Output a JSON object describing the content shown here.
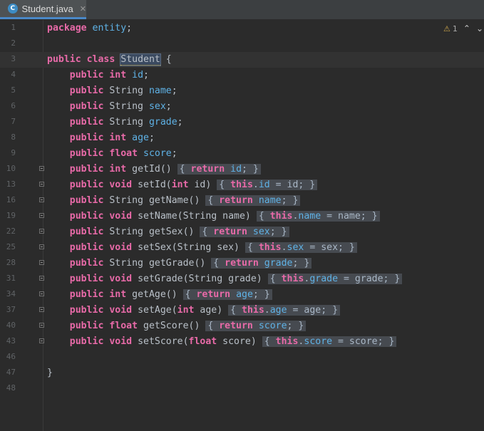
{
  "tab": {
    "icon_letter": "C",
    "label": "Student.java",
    "close": "✕"
  },
  "inspection": {
    "icon": "⚠",
    "count": "1",
    "up": "⌃",
    "down": "⌄"
  },
  "lines": [
    {
      "n": "1",
      "type": "package"
    },
    {
      "n": "2",
      "type": "blank"
    },
    {
      "n": "3",
      "type": "class"
    },
    {
      "n": "4",
      "type": "field",
      "t": "int",
      "f": "id"
    },
    {
      "n": "5",
      "type": "field",
      "t": "String",
      "f": "name"
    },
    {
      "n": "6",
      "type": "field",
      "t": "String",
      "f": "sex"
    },
    {
      "n": "7",
      "type": "field",
      "t": "String",
      "f": "grade"
    },
    {
      "n": "8",
      "type": "field",
      "t": "int",
      "f": "age"
    },
    {
      "n": "9",
      "type": "field",
      "t": "float",
      "f": "score"
    },
    {
      "n": "10",
      "type": "getter",
      "t": "int",
      "m": "getId",
      "f": "id"
    },
    {
      "n": "13",
      "type": "setter",
      "m": "setId",
      "pt": "int",
      "p": "id",
      "f": "id"
    },
    {
      "n": "16",
      "type": "getter",
      "t": "String",
      "m": "getName",
      "f": "name"
    },
    {
      "n": "19",
      "type": "setter",
      "m": "setName",
      "pt": "String",
      "p": "name",
      "f": "name"
    },
    {
      "n": "22",
      "type": "getter",
      "t": "String",
      "m": "getSex",
      "f": "sex"
    },
    {
      "n": "25",
      "type": "setter",
      "m": "setSex",
      "pt": "String",
      "p": "sex",
      "f": "sex"
    },
    {
      "n": "28",
      "type": "getter",
      "t": "String",
      "m": "getGrade",
      "f": "grade"
    },
    {
      "n": "31",
      "type": "setter",
      "m": "setGrade",
      "pt": "String",
      "p": "grade",
      "f": "grade"
    },
    {
      "n": "34",
      "type": "getter",
      "t": "int",
      "m": "getAge",
      "f": "age"
    },
    {
      "n": "37",
      "type": "setter",
      "m": "setAge",
      "pt": "int",
      "p": "age",
      "f": "age"
    },
    {
      "n": "40",
      "type": "getter",
      "t": "float",
      "m": "getScore",
      "f": "score"
    },
    {
      "n": "43",
      "type": "setter",
      "m": "setScore",
      "pt": "float",
      "p": "score",
      "f": "score"
    },
    {
      "n": "46",
      "type": "blank"
    },
    {
      "n": "47",
      "type": "close"
    },
    {
      "n": "48",
      "type": "blank"
    }
  ],
  "keywords": {
    "package": "package",
    "public": "public",
    "class": "class",
    "void": "void",
    "return": "return",
    "this": "this"
  },
  "package_name": "entity",
  "class_name": "Student",
  "current_line": "3"
}
